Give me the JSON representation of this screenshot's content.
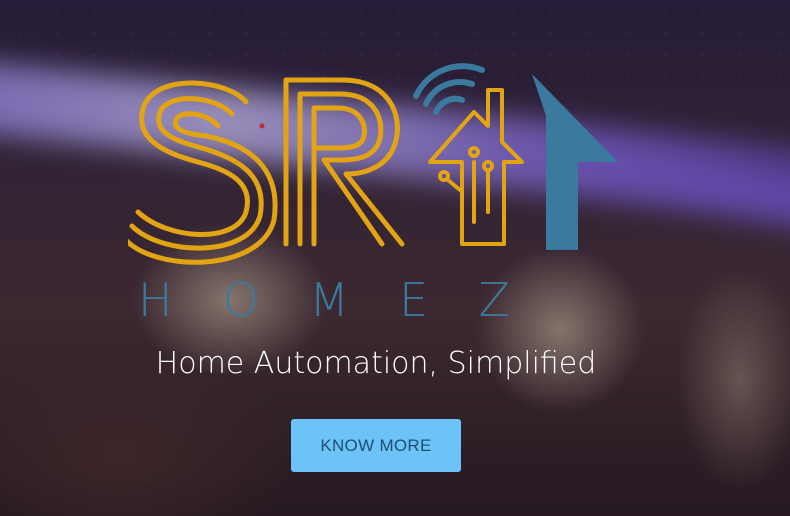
{
  "hero": {
    "logo": {
      "brand_mark": "SR",
      "wordmark": "HOMEZ",
      "colors": {
        "gold": "#e2a413",
        "blue": "#3b7a9e"
      }
    },
    "tagline": "Home Automation, Simplified",
    "cta_label": "KNOW MORE"
  },
  "colors": {
    "cta_background": "#6cc3f7",
    "cta_text": "#1f4f73",
    "tagline_text": "#ffffff"
  }
}
